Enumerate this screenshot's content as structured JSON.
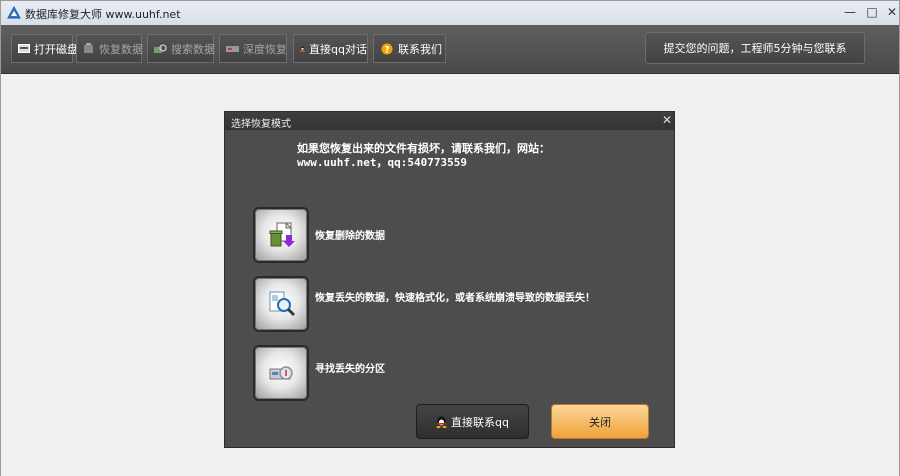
{
  "window": {
    "title": "数据库修复大师 www.uuhf.net"
  },
  "toolbar": {
    "open_disk": "打开磁盘",
    "recover_data": "恢复数据",
    "search_data": "搜索数据",
    "deep_recover": "深度恢复",
    "qq_chat": "直接qq对话",
    "contact_us": "联系我们",
    "submit_issue": "提交您的问题，工程师5分钟与您联系"
  },
  "dialog": {
    "title": "选择恢复模式",
    "message": "如果您恢复出来的文件有损坏，请联系我们，网站：www.uuhf.net，qq:540773559",
    "options": [
      {
        "label": "恢复删除的数据",
        "icon": "recycle-bin-icon"
      },
      {
        "label": "恢复丢失的数据，快速格式化，或者系统崩溃导致的数据丢失！",
        "icon": "magnifier-document-icon"
      },
      {
        "label": "寻找丢失的分区",
        "icon": "partition-search-icon"
      }
    ],
    "qq_button": "直接联系qq",
    "close_button": "关闭"
  },
  "colors": {
    "toolbar_bg": "#4a4a4a",
    "dialog_bg": "#4d4d4d",
    "close_button": "#f0a23a"
  }
}
